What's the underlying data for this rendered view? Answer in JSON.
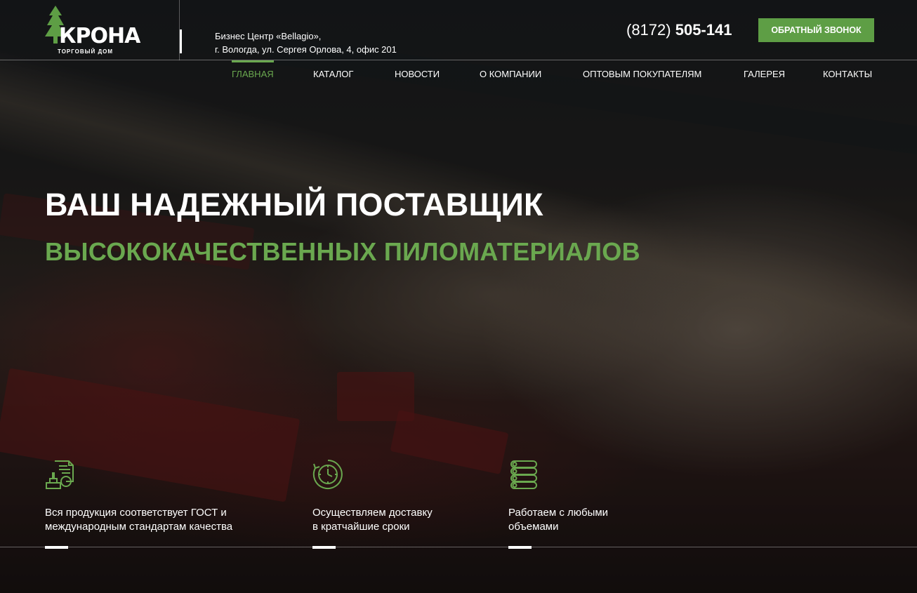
{
  "brand": {
    "name": "КРОНА",
    "tagline": "ТОРГОВЫЙ ДОМ",
    "accent": "#6aa84f"
  },
  "header": {
    "address_line1": "Бизнес Центр «Bellagio»,",
    "address_line2": "г. Вологда, ул. Сергея Орлова, 4, офис 201",
    "phone_code": "(8172)",
    "phone_number": "505-141",
    "callback_label": "ОБРАТНЫЙ ЗВОНОК"
  },
  "nav": {
    "items": [
      {
        "label": "ГЛАВНАЯ",
        "active": true
      },
      {
        "label": "КАТАЛОГ"
      },
      {
        "label": "НОВОСТИ"
      },
      {
        "label": "О КОМПАНИИ"
      },
      {
        "label": "ОПТОВЫМ ПОКУПАТЕЛЯМ"
      },
      {
        "label": "ГАЛЕРЕЯ"
      },
      {
        "label": "КОНТАКТЫ"
      }
    ]
  },
  "hero": {
    "title": "ВАШ НАДЕЖНЫЙ ПОСТАВЩИК",
    "subtitle": "ВЫСОКОКАЧЕСТВЕННЫХ ПИЛОМАТЕРИАЛОВ"
  },
  "features": [
    {
      "icon": "certificate-icon",
      "line1": "Вся продукция соответствует ГОСТ и",
      "line2": "международным стандартам качества"
    },
    {
      "icon": "clock-icon",
      "line1": "Осуществляем доставку",
      "line2": "в кратчайшие сроки"
    },
    {
      "icon": "lumber-stack-icon",
      "line1": "Работаем с любыми",
      "line2": "объемами"
    }
  ]
}
